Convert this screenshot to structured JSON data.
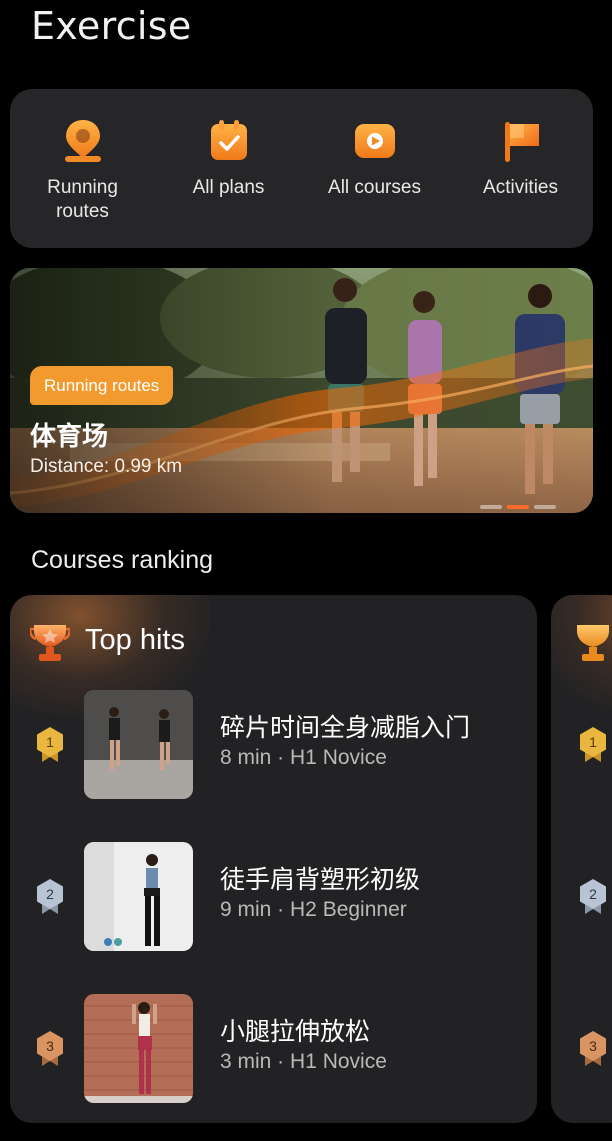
{
  "page": {
    "title": "Exercise"
  },
  "quick_links": [
    {
      "label": "Running\nroutes",
      "icon": "location-pin-icon"
    },
    {
      "label": "All plans",
      "icon": "calendar-check-icon"
    },
    {
      "label": "All courses",
      "icon": "play-icon"
    },
    {
      "label": "Activities",
      "icon": "flag-icon"
    }
  ],
  "banner": {
    "tag": "Running routes",
    "title": "体育场",
    "distance": "Distance: 0.99 km",
    "slides": 3,
    "active_slide": 2
  },
  "ranking": {
    "section_title": "Courses ranking",
    "card_title": "Top hits",
    "items": [
      {
        "rank": "1",
        "name": "碎片时间全身减脂入门",
        "meta": "8 min · H1 Novice"
      },
      {
        "rank": "2",
        "name": "徒手肩背塑形初级",
        "meta": "9 min · H2 Beginner"
      },
      {
        "rank": "3",
        "name": "小腿拉伸放松",
        "meta": "3 min · H1 Novice"
      }
    ],
    "peek_ranks": [
      "1",
      "2",
      "3"
    ]
  },
  "colors": {
    "accent": "#f39a2e",
    "card_bg": "#262628",
    "gold": "#e9b640",
    "silver": "#b8c4d4",
    "bronze": "#d99462"
  }
}
